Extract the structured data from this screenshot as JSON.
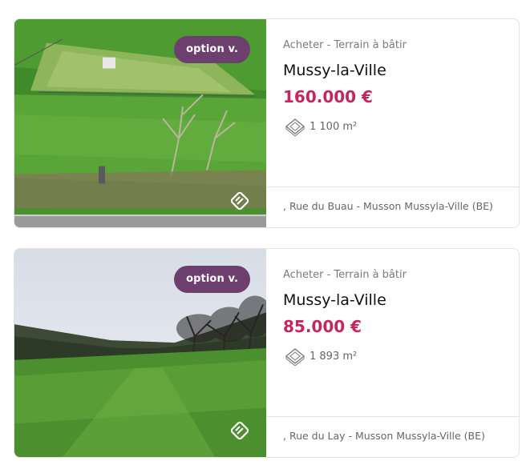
{
  "listings": [
    {
      "badge": "option v.",
      "type": "Acheter - Terrain à bâtir",
      "city": "Mussy-la-Ville",
      "price": "160.000 €",
      "area": "1 100 m²",
      "address": ", Rue du Buau - Musson Mussyla-Ville (BE)"
    },
    {
      "badge": "option v.",
      "type": "Acheter - Terrain à bâtir",
      "city": "Mussy-la-Ville",
      "price": "85.000 €",
      "area": "1 893 m²",
      "address": ", Rue du Lay - Musson Mussyla-Ville (BE)"
    }
  ],
  "icons": {
    "area": "land-area-icon",
    "virtual_tour": "virtual-tour-icon"
  },
  "colors": {
    "badge": "#6d3f6e",
    "price": "#c8265a"
  }
}
